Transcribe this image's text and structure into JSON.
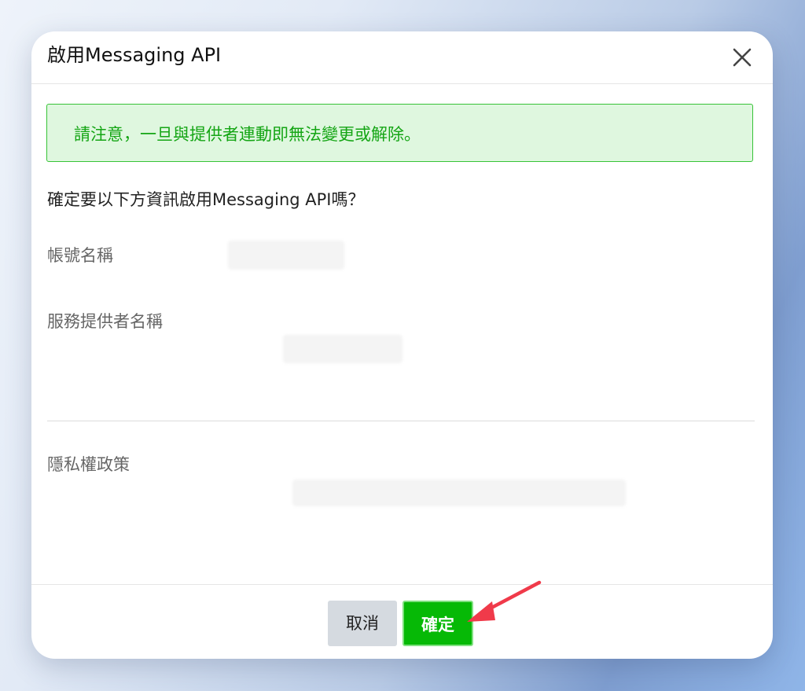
{
  "dialog": {
    "title": "啟用Messaging API",
    "notice": "請注意，一旦與提供者連動即無法變更或解除。",
    "question": "確定要以下方資訊啟用Messaging API嗎？",
    "fields": [
      {
        "label": "帳號名稱"
      },
      {
        "label": "服務提供者名稱"
      },
      {
        "label": "隱私權政策"
      }
    ],
    "buttons": {
      "cancel": "取消",
      "confirm": "確定"
    }
  },
  "colors": {
    "accent_green": "#06b906",
    "notice_bg": "#dff7df",
    "notice_border": "#37c337",
    "notice_text": "#14a514",
    "annotation_arrow": "#f03a4a"
  },
  "icons": {
    "close": "close-icon",
    "annotation": "red-arrow-annotation"
  }
}
